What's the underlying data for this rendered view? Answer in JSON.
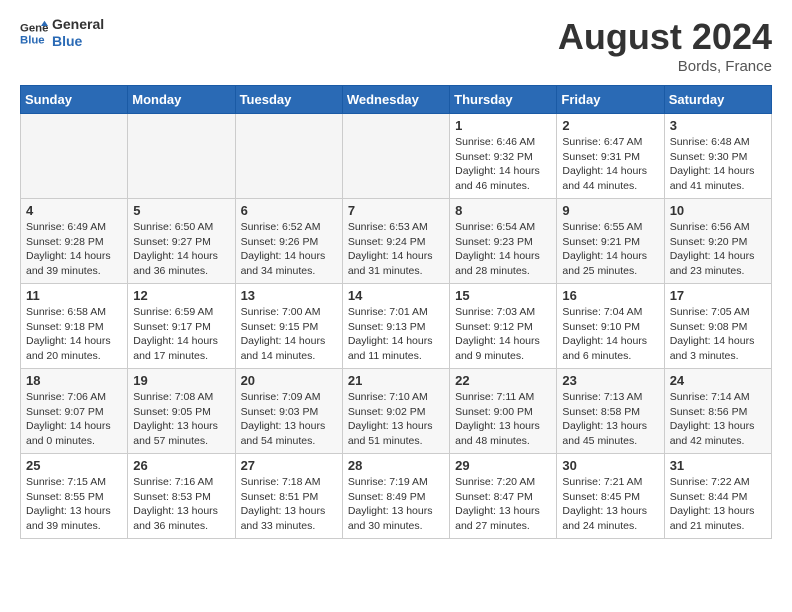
{
  "header": {
    "logo_line1": "General",
    "logo_line2": "Blue",
    "month_year": "August 2024",
    "location": "Bords, France"
  },
  "weekdays": [
    "Sunday",
    "Monday",
    "Tuesday",
    "Wednesday",
    "Thursday",
    "Friday",
    "Saturday"
  ],
  "weeks": [
    [
      {
        "day": "",
        "empty": true
      },
      {
        "day": "",
        "empty": true
      },
      {
        "day": "",
        "empty": true
      },
      {
        "day": "",
        "empty": true
      },
      {
        "day": "1",
        "sunrise": "6:46 AM",
        "sunset": "9:32 PM",
        "daylight": "14 hours and 46 minutes."
      },
      {
        "day": "2",
        "sunrise": "6:47 AM",
        "sunset": "9:31 PM",
        "daylight": "14 hours and 44 minutes."
      },
      {
        "day": "3",
        "sunrise": "6:48 AM",
        "sunset": "9:30 PM",
        "daylight": "14 hours and 41 minutes."
      }
    ],
    [
      {
        "day": "4",
        "sunrise": "6:49 AM",
        "sunset": "9:28 PM",
        "daylight": "14 hours and 39 minutes."
      },
      {
        "day": "5",
        "sunrise": "6:50 AM",
        "sunset": "9:27 PM",
        "daylight": "14 hours and 36 minutes."
      },
      {
        "day": "6",
        "sunrise": "6:52 AM",
        "sunset": "9:26 PM",
        "daylight": "14 hours and 34 minutes."
      },
      {
        "day": "7",
        "sunrise": "6:53 AM",
        "sunset": "9:24 PM",
        "daylight": "14 hours and 31 minutes."
      },
      {
        "day": "8",
        "sunrise": "6:54 AM",
        "sunset": "9:23 PM",
        "daylight": "14 hours and 28 minutes."
      },
      {
        "day": "9",
        "sunrise": "6:55 AM",
        "sunset": "9:21 PM",
        "daylight": "14 hours and 25 minutes."
      },
      {
        "day": "10",
        "sunrise": "6:56 AM",
        "sunset": "9:20 PM",
        "daylight": "14 hours and 23 minutes."
      }
    ],
    [
      {
        "day": "11",
        "sunrise": "6:58 AM",
        "sunset": "9:18 PM",
        "daylight": "14 hours and 20 minutes."
      },
      {
        "day": "12",
        "sunrise": "6:59 AM",
        "sunset": "9:17 PM",
        "daylight": "14 hours and 17 minutes."
      },
      {
        "day": "13",
        "sunrise": "7:00 AM",
        "sunset": "9:15 PM",
        "daylight": "14 hours and 14 minutes."
      },
      {
        "day": "14",
        "sunrise": "7:01 AM",
        "sunset": "9:13 PM",
        "daylight": "14 hours and 11 minutes."
      },
      {
        "day": "15",
        "sunrise": "7:03 AM",
        "sunset": "9:12 PM",
        "daylight": "14 hours and 9 minutes."
      },
      {
        "day": "16",
        "sunrise": "7:04 AM",
        "sunset": "9:10 PM",
        "daylight": "14 hours and 6 minutes."
      },
      {
        "day": "17",
        "sunrise": "7:05 AM",
        "sunset": "9:08 PM",
        "daylight": "14 hours and 3 minutes."
      }
    ],
    [
      {
        "day": "18",
        "sunrise": "7:06 AM",
        "sunset": "9:07 PM",
        "daylight": "14 hours and 0 minutes."
      },
      {
        "day": "19",
        "sunrise": "7:08 AM",
        "sunset": "9:05 PM",
        "daylight": "13 hours and 57 minutes."
      },
      {
        "day": "20",
        "sunrise": "7:09 AM",
        "sunset": "9:03 PM",
        "daylight": "13 hours and 54 minutes."
      },
      {
        "day": "21",
        "sunrise": "7:10 AM",
        "sunset": "9:02 PM",
        "daylight": "13 hours and 51 minutes."
      },
      {
        "day": "22",
        "sunrise": "7:11 AM",
        "sunset": "9:00 PM",
        "daylight": "13 hours and 48 minutes."
      },
      {
        "day": "23",
        "sunrise": "7:13 AM",
        "sunset": "8:58 PM",
        "daylight": "13 hours and 45 minutes."
      },
      {
        "day": "24",
        "sunrise": "7:14 AM",
        "sunset": "8:56 PM",
        "daylight": "13 hours and 42 minutes."
      }
    ],
    [
      {
        "day": "25",
        "sunrise": "7:15 AM",
        "sunset": "8:55 PM",
        "daylight": "13 hours and 39 minutes."
      },
      {
        "day": "26",
        "sunrise": "7:16 AM",
        "sunset": "8:53 PM",
        "daylight": "13 hours and 36 minutes."
      },
      {
        "day": "27",
        "sunrise": "7:18 AM",
        "sunset": "8:51 PM",
        "daylight": "13 hours and 33 minutes."
      },
      {
        "day": "28",
        "sunrise": "7:19 AM",
        "sunset": "8:49 PM",
        "daylight": "13 hours and 30 minutes."
      },
      {
        "day": "29",
        "sunrise": "7:20 AM",
        "sunset": "8:47 PM",
        "daylight": "13 hours and 27 minutes."
      },
      {
        "day": "30",
        "sunrise": "7:21 AM",
        "sunset": "8:45 PM",
        "daylight": "13 hours and 24 minutes."
      },
      {
        "day": "31",
        "sunrise": "7:22 AM",
        "sunset": "8:44 PM",
        "daylight": "13 hours and 21 minutes."
      }
    ]
  ],
  "labels": {
    "sunrise_prefix": "Sunrise: ",
    "sunset_prefix": "Sunset: ",
    "daylight_prefix": "Daylight: "
  }
}
